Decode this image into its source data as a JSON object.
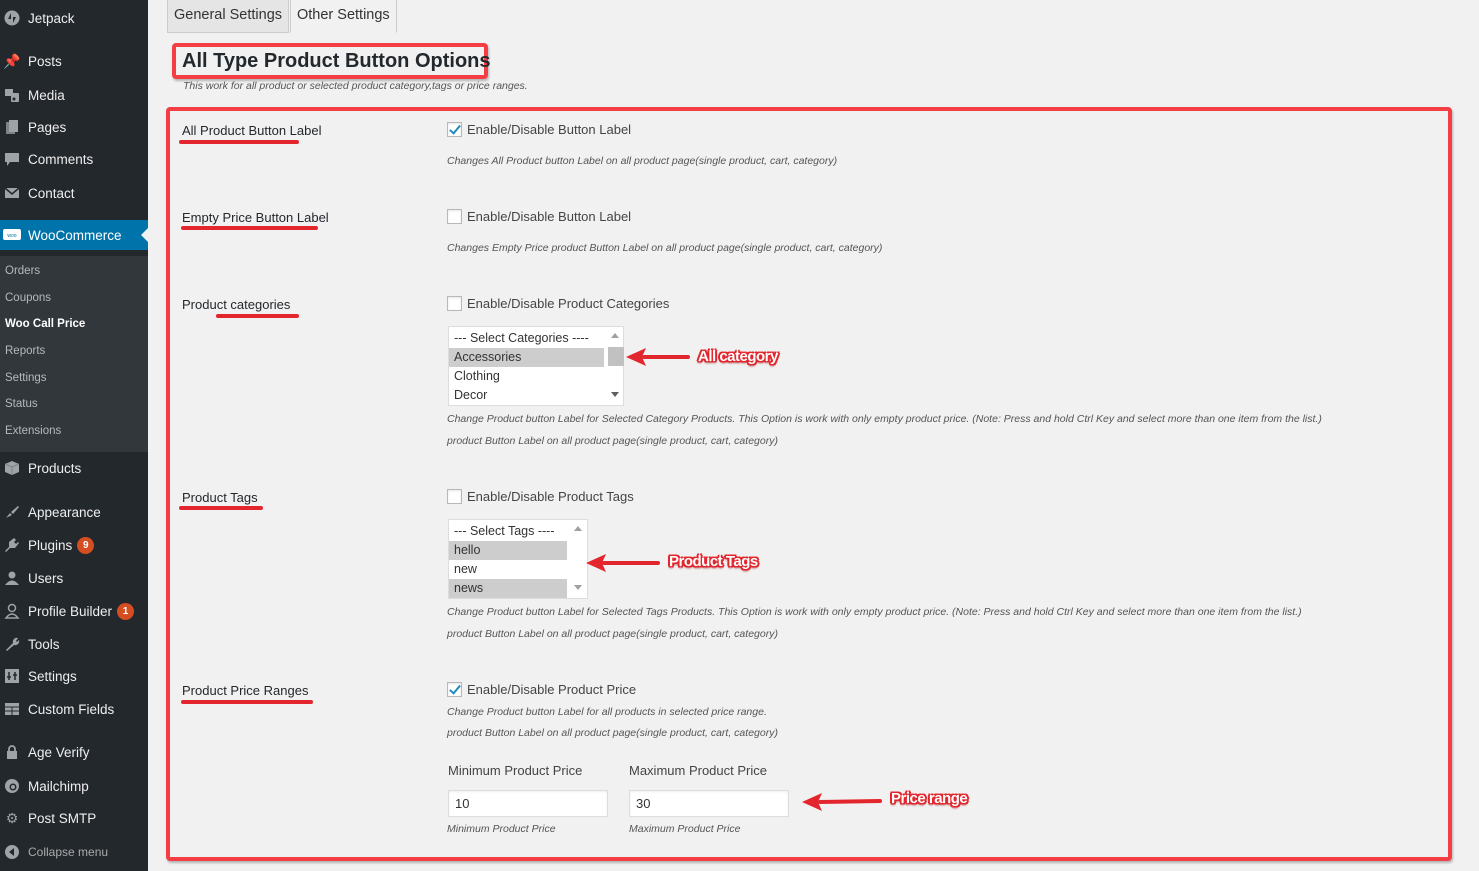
{
  "sidebar": {
    "items": [
      {
        "label": "Jetpack",
        "icon": "jetpack-icon"
      },
      {
        "label": "Posts",
        "icon": "pin-icon"
      },
      {
        "label": "Media",
        "icon": "media-icon"
      },
      {
        "label": "Pages",
        "icon": "pages-icon"
      },
      {
        "label": "Comments",
        "icon": "comment-icon"
      },
      {
        "label": "Contact",
        "icon": "envelope-icon"
      },
      {
        "label": "WooCommerce",
        "icon": "woo-icon"
      },
      {
        "label": "Products",
        "icon": "box-icon"
      },
      {
        "label": "Appearance",
        "icon": "brush-icon"
      },
      {
        "label": "Plugins",
        "icon": "plug-icon",
        "badge": "9"
      },
      {
        "label": "Users",
        "icon": "user-icon"
      },
      {
        "label": "Profile Builder",
        "icon": "profile-icon",
        "badge": "1"
      },
      {
        "label": "Tools",
        "icon": "wrench-icon"
      },
      {
        "label": "Settings",
        "icon": "settings-icon"
      },
      {
        "label": "Custom Fields",
        "icon": "grid-icon"
      },
      {
        "label": "Age Verify",
        "icon": "lock-icon"
      },
      {
        "label": "Mailchimp",
        "icon": "mailchimp-icon"
      },
      {
        "label": "Post SMTP",
        "icon": "gear-icon"
      },
      {
        "label": "Collapse menu",
        "icon": "collapse-icon"
      }
    ],
    "woocommerce_submenu": [
      "Orders",
      "Coupons",
      "Woo Call Price",
      "Reports",
      "Settings",
      "Status",
      "Extensions"
    ],
    "current_submenu": "Woo Call Price"
  },
  "tabs": [
    {
      "label": "General Settings",
      "active": false
    },
    {
      "label": "Other Settings",
      "active": true
    }
  ],
  "page": {
    "title": "All Type Product Button Options",
    "description": "This work for all product or selected product category,tags or price ranges."
  },
  "sections": {
    "all_product": {
      "label": "All Product Button Label",
      "checkbox_label": "Enable/Disable Button Label",
      "checked": true,
      "desc": "Changes All Product button Label on all product page(single product, cart, category)"
    },
    "empty_price": {
      "label": "Empty Price Button Label",
      "checkbox_label": "Enable/Disable Button Label",
      "checked": false,
      "desc": "Changes Empty Price product Button Label on all product page(single product, cart, category)"
    },
    "categories": {
      "label": "Product categories",
      "checkbox_label": "Enable/Disable Product Categories",
      "checked": false,
      "options": [
        "--- Select Categories ----",
        "Accessories",
        "Clothing",
        "Decor"
      ],
      "selected": [
        "Accessories"
      ],
      "desc1": "Change Product button Label for Selected Category Products. This Option is work with only empty product price. (Note: Press and hold Ctrl Key and select more than one item from the list.)",
      "desc2": "product Button Label on all product page(single product, cart, category)",
      "callout": "All category"
    },
    "tags": {
      "label": "Product Tags",
      "checkbox_label": "Enable/Disable Product Tags",
      "checked": false,
      "options": [
        "--- Select Tags ----",
        "hello",
        "new",
        "news"
      ],
      "selected": [
        "hello",
        "news"
      ],
      "desc1": "Change Product button Label for Selected Tags Products. This Option is work with only empty product price. (Note: Press and hold Ctrl Key and select more than one item from the list.)",
      "desc2": "product Button Label on all product page(single product, cart, category)",
      "callout": "Product Tags"
    },
    "price": {
      "label": "Product Price Ranges",
      "checkbox_label": "Enable/Disable Product Price",
      "checked": true,
      "desc1": "Change Product button Label for all products in selected price range.",
      "desc2": "product Button Label on all product page(single product, cart, category)",
      "min_label": "Minimum Product Price",
      "max_label": "Maximum Product Price",
      "min_value": "10",
      "max_value": "30",
      "min_hint": "Minimum Product Price",
      "max_hint": "Maximum Product Price",
      "callout": "Price range"
    }
  },
  "colors": {
    "annotation_red": "#e3262d",
    "wp_admin_bar": "#23282d",
    "wp_active_blue": "#0073aa",
    "badge_orange": "#d54e21"
  }
}
